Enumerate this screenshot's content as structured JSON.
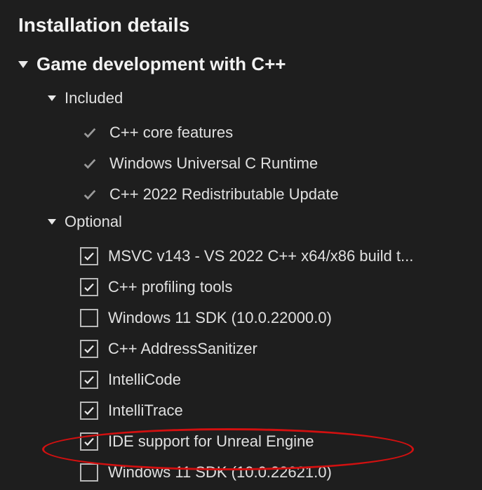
{
  "title": "Installation details",
  "workload": {
    "label": "Game development with C++",
    "groups": {
      "included": {
        "label": "Included",
        "items": [
          {
            "label": "C++ core features"
          },
          {
            "label": "Windows Universal C Runtime"
          },
          {
            "label": "C++ 2022 Redistributable Update"
          }
        ]
      },
      "optional": {
        "label": "Optional",
        "items": [
          {
            "label": "MSVC v143 - VS 2022 C++ x64/x86 build t...",
            "checked": true
          },
          {
            "label": "C++ profiling tools",
            "checked": true
          },
          {
            "label": "Windows 11 SDK (10.0.22000.0)",
            "checked": false
          },
          {
            "label": "C++ AddressSanitizer",
            "checked": true
          },
          {
            "label": "IntelliCode",
            "checked": true
          },
          {
            "label": "IntelliTrace",
            "checked": true
          },
          {
            "label": "IDE support for Unreal Engine",
            "checked": true
          },
          {
            "label": "Windows 11 SDK (10.0.22621.0)",
            "checked": false
          }
        ]
      }
    }
  }
}
